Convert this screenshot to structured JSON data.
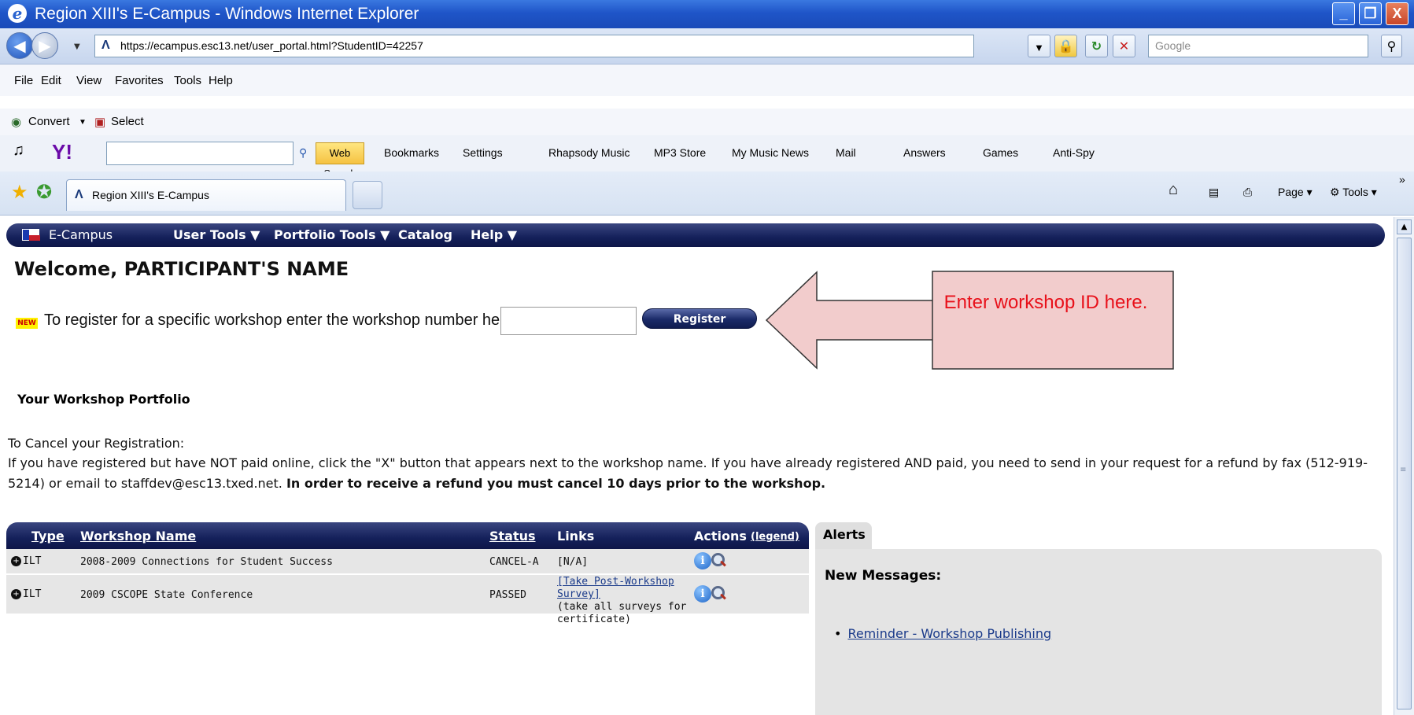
{
  "window": {
    "title": "Region XIII's E-Campus - Windows Internet Explorer",
    "minimize": "_",
    "restore": "❐",
    "close": "X"
  },
  "address": {
    "url": "https://ecampus.esc13.net/user_portal.html?StudentID=42257",
    "search_placeholder": "Google"
  },
  "menu": [
    "File",
    "Edit",
    "View",
    "Favorites",
    "Tools",
    "Help"
  ],
  "convert_bar": {
    "convert": "Convert",
    "select": "Select"
  },
  "yahoo_bar": {
    "web_search": "Web Search",
    "bookmarks": "Bookmarks",
    "settings": "Settings",
    "rhapsody": "Rhapsody Music",
    "mp3": "MP3 Store",
    "music_news": "My Music News",
    "mail": "Mail",
    "answers": "Answers",
    "games": "Games",
    "antispy": "Anti-Spy"
  },
  "tabs": {
    "active_label": "Region XIII's E-Campus",
    "page_label": "Page",
    "tools_label": "Tools"
  },
  "app_nav": {
    "brand": "E-Campus",
    "items": [
      "User Tools ▼",
      "Portfolio Tools ▼",
      "Catalog",
      "Help ▼"
    ]
  },
  "page": {
    "welcome": "Welcome, PARTICIPANT'S NAME",
    "new_badge": "NEW",
    "register_prompt": "To register for a specific workshop enter the workshop number here:",
    "workshop_input_value": "",
    "register_button": "Register",
    "callout_text": "Enter workshop ID here.",
    "portfolio_heading": "Your Workshop Portfolio",
    "cancel_heading": "To Cancel your Registration:",
    "cancel_text": "If you have registered but have NOT paid online, click the \"X\" button that appears next to the workshop name. If you have already registered AND paid, you need to send in your request for a refund by fax (512-919-5214) or email to staffdev@esc13.txed.net.",
    "cancel_bold": "In order to receive a refund you must cancel 10 days prior to the workshop."
  },
  "grid": {
    "headers": {
      "type": "Type",
      "name": "Workshop Name",
      "status": "Status",
      "links": "Links",
      "actions": "Actions",
      "legend": "(legend)"
    },
    "rows": [
      {
        "type": "ILT",
        "name": "2008-2009 Connections for Student Success",
        "status": "CANCEL-A",
        "links": "[N/A]",
        "link_note": ""
      },
      {
        "type": "ILT",
        "name": "2009 CSCOPE State Conference",
        "status": "PASSED",
        "links": "[Take Post-Workshop Survey]",
        "link_note": "(take all surveys for certificate)"
      }
    ]
  },
  "alerts": {
    "tab": "Alerts",
    "heading": "New Messages:",
    "items": [
      "Reminder - Workshop Publishing"
    ]
  },
  "colors": {
    "nav_bar": "#14205a",
    "callout_fill": "#f2cccc",
    "callout_text": "#e8101a",
    "titlebar": "#1f55c8"
  }
}
